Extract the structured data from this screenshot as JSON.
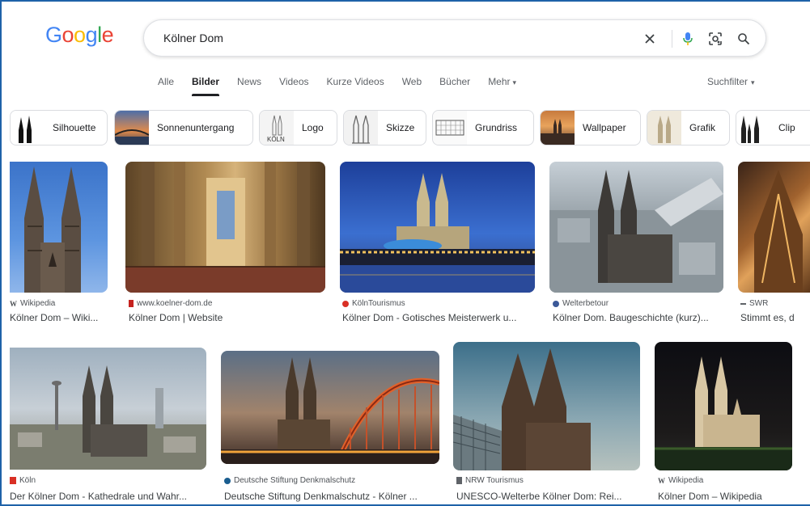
{
  "header": {
    "logo_letters": [
      {
        "char": "G",
        "color": "#4285F4"
      },
      {
        "char": "o",
        "color": "#EA4335"
      },
      {
        "char": "o",
        "color": "#FBBC05"
      },
      {
        "char": "g",
        "color": "#4285F4"
      },
      {
        "char": "l",
        "color": "#34A853"
      },
      {
        "char": "e",
        "color": "#EA4335"
      }
    ],
    "search_value": "Kölner Dom",
    "icons": [
      "close-icon",
      "microphone-icon",
      "lens-icon",
      "search-icon"
    ]
  },
  "tabs": [
    {
      "label": "Alle",
      "active": false
    },
    {
      "label": "Bilder",
      "active": true
    },
    {
      "label": "News",
      "active": false
    },
    {
      "label": "Videos",
      "active": false
    },
    {
      "label": "Kurze Videos",
      "active": false
    },
    {
      "label": "Web",
      "active": false
    },
    {
      "label": "Bücher",
      "active": false
    },
    {
      "label": "Mehr",
      "active": false
    }
  ],
  "suchfilter": "Suchfilter",
  "chips": [
    {
      "label": "Silhouette"
    },
    {
      "label": "Sonnenuntergang"
    },
    {
      "label": "Logo",
      "thumb_text": "KÖLN"
    },
    {
      "label": "Skizze"
    },
    {
      "label": "Grundriss"
    },
    {
      "label": "Wallpaper"
    },
    {
      "label": "Grafik"
    },
    {
      "label": "Clip"
    }
  ],
  "results": [
    {
      "source": "Wikipedia",
      "title": "Kölner Dom – Wiki...",
      "favicon": "W",
      "favicon_color": "#202124"
    },
    {
      "source": "www.koelner-dom.de",
      "title": "Kölner Dom | Website",
      "favicon": "",
      "favicon_color": "#c5221f"
    },
    {
      "source": "KölnTourismus",
      "title": "Kölner Dom - Gotisches Meisterwerk u...",
      "favicon": "",
      "favicon_color": "#d93025"
    },
    {
      "source": "Welterbetour",
      "title": "Kölner Dom. Baugeschichte (kurz)...",
      "favicon": "",
      "favicon_color": "#3b5998"
    },
    {
      "source": "SWR",
      "title": "Stimmt es, d",
      "favicon": "",
      "favicon_color": "#5f6368"
    },
    {
      "source": "Köln",
      "title": "Der Kölner Dom - Kathedrale und Wahr...",
      "favicon": "",
      "favicon_color": "#d93025"
    },
    {
      "source": "Deutsche Stiftung Denkmalschutz",
      "title": "Deutsche Stiftung Denkmalschutz - Kölner ...",
      "favicon": "",
      "favicon_color": "#1a5d8f"
    },
    {
      "source": "NRW Tourismus",
      "title": "UNESCO-Welterbe Kölner Dom: Rei...",
      "favicon": "",
      "favicon_color": "#5f6368"
    },
    {
      "source": "Wikipedia",
      "title": "Kölner Dom – Wikipedia",
      "favicon": "W",
      "favicon_color": "#202124"
    }
  ]
}
